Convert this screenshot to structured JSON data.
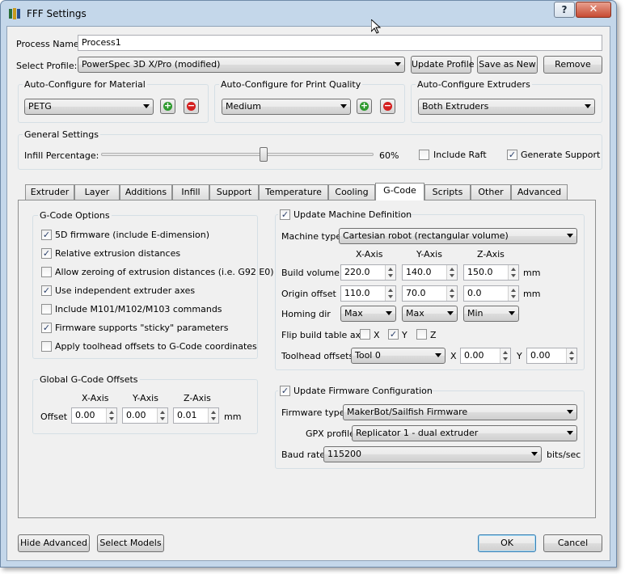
{
  "window": {
    "title": "FFF Settings",
    "help_label": "?",
    "close_label": "✕"
  },
  "process": {
    "name_label": "Process Name:",
    "name_value": "Process1"
  },
  "profile": {
    "label": "Select Profile:",
    "value": "PowerSpec 3D X/Pro (modified)",
    "update_label": "Update Profile",
    "save_label": "Save as New",
    "remove_label": "Remove"
  },
  "auto_material": {
    "title": "Auto-Configure for Material",
    "value": "PETG"
  },
  "auto_quality": {
    "title": "Auto-Configure for Print Quality",
    "value": "Medium"
  },
  "auto_extruders": {
    "title": "Auto-Configure Extruders",
    "value": "Both Extruders"
  },
  "general": {
    "title": "General Settings",
    "infill_label": "Infill Percentage:",
    "infill_value": "60%",
    "infill_fraction": 0.6,
    "raft_label": "Include Raft",
    "raft_checked": false,
    "support_label": "Generate Support",
    "support_checked": true
  },
  "tabs": [
    "Extruder",
    "Layer",
    "Additions",
    "Infill",
    "Support",
    "Temperature",
    "Cooling",
    "G-Code",
    "Scripts",
    "Other",
    "Advanced"
  ],
  "active_tab": "G-Code",
  "gcode_options": {
    "title": "G-Code Options",
    "items": [
      {
        "label": "5D firmware (include E-dimension)",
        "checked": true
      },
      {
        "label": "Relative extrusion distances",
        "checked": true
      },
      {
        "label": "Allow zeroing of extrusion distances (i.e. G92 E0)",
        "checked": false
      },
      {
        "label": "Use independent extruder axes",
        "checked": true
      },
      {
        "label": "Include M101/M102/M103 commands",
        "checked": false
      },
      {
        "label": "Firmware supports \"sticky\" parameters",
        "checked": true
      },
      {
        "label": "Apply toolhead offsets to G-Code coordinates",
        "checked": false
      }
    ]
  },
  "global_offsets": {
    "title": "Global G-Code Offsets",
    "x_header": "X-Axis",
    "y_header": "Y-Axis",
    "z_header": "Z-Axis",
    "row_label": "Offset",
    "x": "0.00",
    "y": "0.00",
    "z": "0.01",
    "unit": "mm"
  },
  "machine": {
    "title": "Update Machine Definition",
    "checked": true,
    "type_label": "Machine type",
    "type_value": "Cartesian robot (rectangular volume)",
    "x_header": "X-Axis",
    "y_header": "Y-Axis",
    "z_header": "Z-Axis",
    "build_label": "Build volume",
    "build_x": "220.0",
    "build_y": "140.0",
    "build_z": "150.0",
    "build_unit": "mm",
    "origin_label": "Origin offset",
    "origin_x": "110.0",
    "origin_y": "70.0",
    "origin_z": "0.0",
    "origin_unit": "mm",
    "homing_label": "Homing dir",
    "homing_x": "Max",
    "homing_y": "Max",
    "homing_z": "Min",
    "flip_label": "Flip build table axis",
    "flip_x_label": "X",
    "flip_x": false,
    "flip_y_label": "Y",
    "flip_y": true,
    "flip_z_label": "Z",
    "flip_z": false,
    "toolhead_label": "Toolhead offsets",
    "toolhead_value": "Tool 0",
    "toolhead_x_label": "X",
    "toolhead_x": "0.00",
    "toolhead_y_label": "Y",
    "toolhead_y": "0.00"
  },
  "firmware": {
    "title": "Update Firmware Configuration",
    "checked": true,
    "type_label": "Firmware type",
    "type_value": "MakerBot/Sailfish Firmware",
    "gpx_label": "GPX profile",
    "gpx_value": "Replicator 1 - dual extruder",
    "baud_label": "Baud rate",
    "baud_value": "115200",
    "baud_unit": "bits/sec"
  },
  "footer": {
    "hide_label": "Hide Advanced",
    "models_label": "Select Models",
    "ok_label": "OK",
    "cancel_label": "Cancel"
  },
  "colors": {
    "title_bar": "#c4d7ea",
    "dialog_bg": "#f0f0f0",
    "add_icon": "#2f9a2f",
    "remove_icon": "#d42020",
    "ok_border": "#3c7fb1"
  }
}
